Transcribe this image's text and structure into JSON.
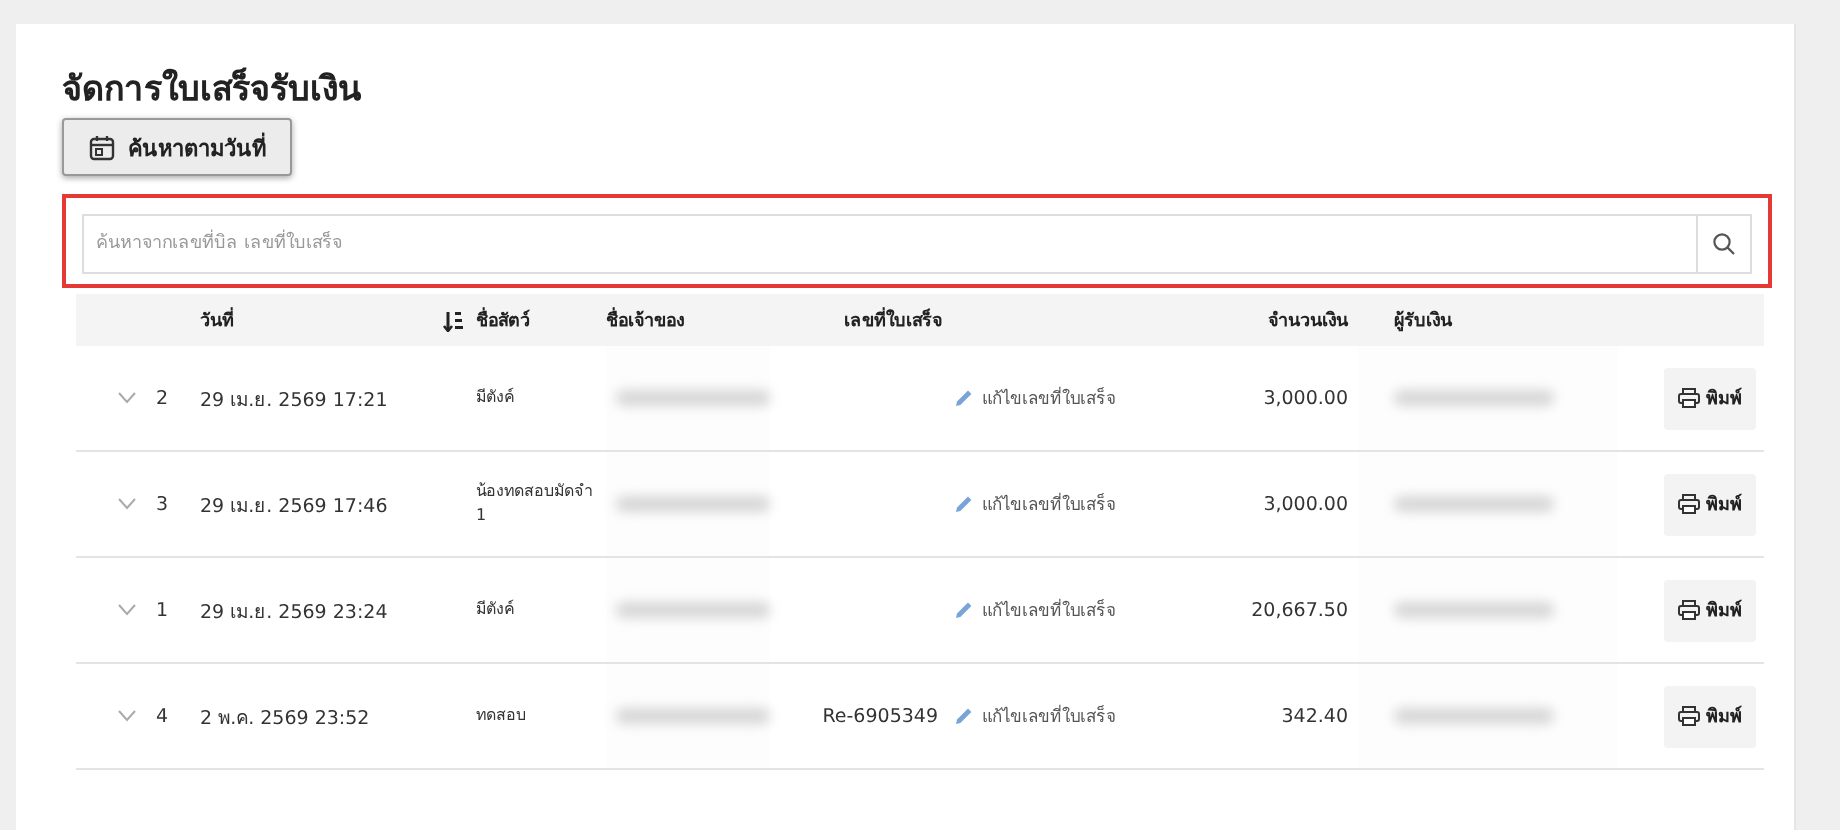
{
  "title": "จัดการใบเสร็จรับเงิน",
  "date_search_button": "ค้นหาตามวันที่",
  "search": {
    "placeholder": "ค้นหาจากเลขที่บิล เลขที่ใบเสร็จ"
  },
  "table": {
    "columns": [
      "วันที่",
      "ชื่อสัตว์",
      "ชื่อเจ้าของ",
      "เลขที่ใบเสร็จ",
      "จำนวนเงิน",
      "ผู้รับเงิน"
    ],
    "rows": [
      {
        "number": "2",
        "date": "29 เม.ย. 2569 17:21",
        "pet": "มีตังค์",
        "receipt_no": "",
        "edit": "แก้ไขเลขที่ใบเสร็จ",
        "amount": "3,000.00",
        "print": "พิมพ์"
      },
      {
        "number": "3",
        "date": "29 เม.ย. 2569 17:46",
        "pet": "น้องทดสอบมัดจำ\n1",
        "receipt_no": "",
        "edit": "แก้ไขเลขที่ใบเสร็จ",
        "amount": "3,000.00",
        "print": "พิมพ์"
      },
      {
        "number": "1",
        "date": "29 เม.ย. 2569 23:24",
        "pet": "มีตังค์",
        "receipt_no": "",
        "edit": "แก้ไขเลขที่ใบเสร็จ",
        "amount": "20,667.50",
        "print": "พิมพ์"
      },
      {
        "number": "4",
        "date": "2 พ.ค. 2569 23:52",
        "pet": "ทดสอบ",
        "receipt_no": "Re-6905349",
        "edit": "แก้ไขเลขที่ใบเสร็จ",
        "amount": "342.40",
        "print": "พิมพ์"
      }
    ]
  }
}
